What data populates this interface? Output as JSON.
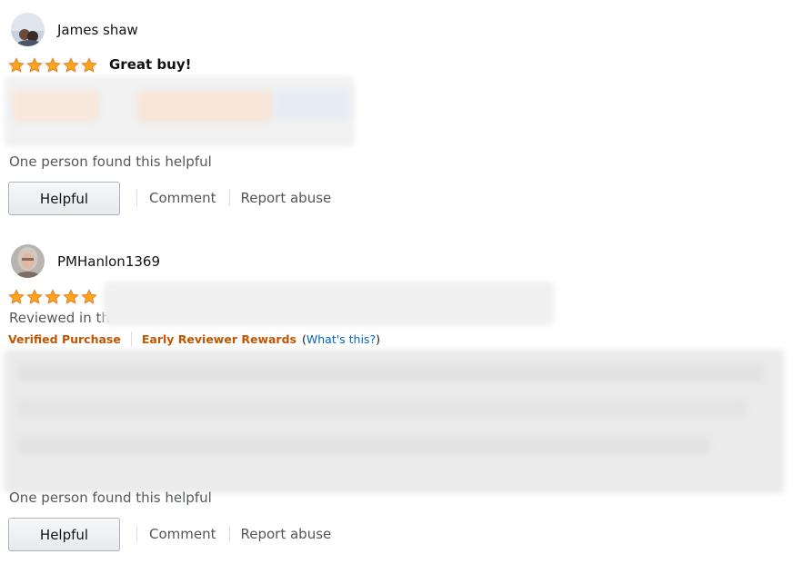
{
  "reviews": [
    {
      "author": "James shaw",
      "rating": 5,
      "title": "Great buy!",
      "helpful_text": "One person found this helpful",
      "buttons": {
        "helpful": "Helpful",
        "comment": "Comment",
        "report": "Report abuse"
      }
    },
    {
      "author": "PMHanlon1369",
      "rating": 5,
      "reviewed_in": "Reviewed in th",
      "badges": {
        "verified": "Verified Purchase",
        "early": "Early Reviewer Rewards",
        "whats_open": "(",
        "whats": "What's this?",
        "whats_close": ")"
      },
      "helpful_text": "One person found this helpful",
      "buttons": {
        "helpful": "Helpful",
        "comment": "Comment",
        "report": "Report abuse"
      }
    }
  ],
  "colors": {
    "star": "#FFA41C",
    "star_border": "#DE7921",
    "link": "#0066c0",
    "badge": "#c45500"
  },
  "icons": {
    "star": "star-icon",
    "avatar": "user-avatar"
  }
}
